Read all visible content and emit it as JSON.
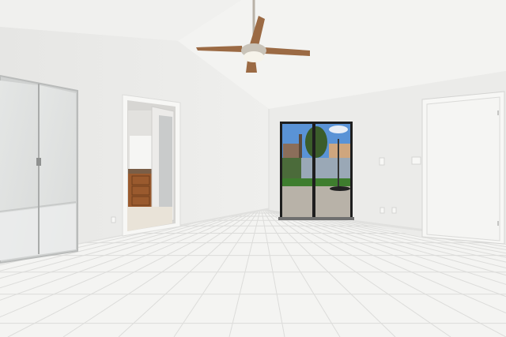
{
  "palette": {
    "wall_left": "#e6e6e4",
    "wall_right": "#ebebe9",
    "ceiling": "#f3f3f1",
    "floor": "#f4f4f2",
    "grout": "#dcdcda",
    "trim": "#f7f7f5",
    "door": "#f5f5f3",
    "mirror": "#d9dbda",
    "cabinet": "#9a5a2e",
    "sky": "#5a93d6",
    "grass": "#3e7d2e",
    "fence": "#9aa8b6",
    "patio": "#b8b2a8",
    "tree": "#3b5d2a",
    "fan_blade": "#9b6a44",
    "fan_metal": "#c9c3b8",
    "glass_frame": "#1e1e1e"
  }
}
